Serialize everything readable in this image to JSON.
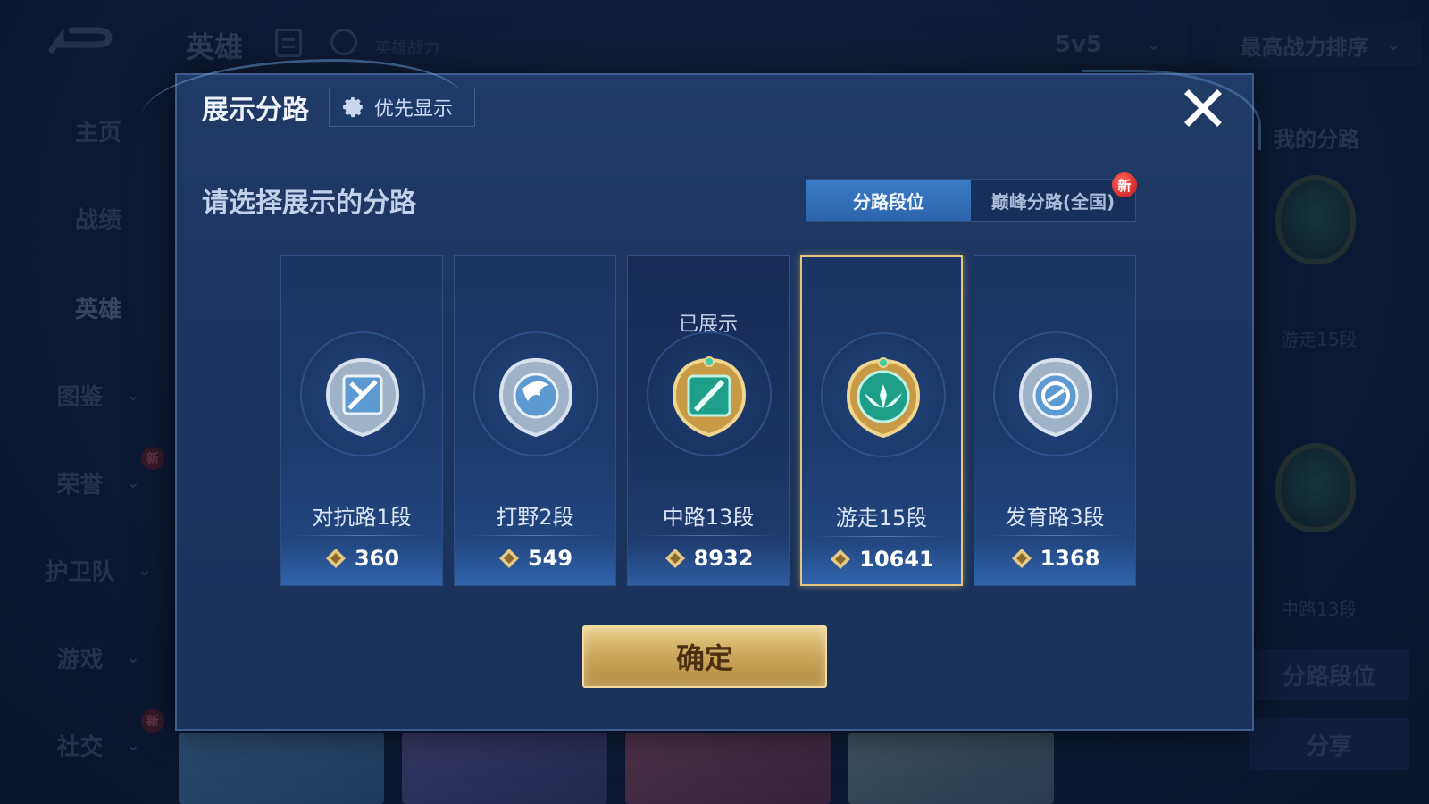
{
  "background": {
    "page_title": "英雄",
    "power_label": "英雄战力",
    "mode_select": "5v5",
    "sort_select": "最高战力排序",
    "sidebar": [
      {
        "label": "主页",
        "badge": "",
        "chevron": false
      },
      {
        "label": "战绩",
        "badge": "",
        "chevron": false
      },
      {
        "label": "英雄",
        "badge": "",
        "chevron": false,
        "active": true
      },
      {
        "label": "图鉴",
        "badge": "",
        "chevron": true
      },
      {
        "label": "荣誉",
        "badge": "新",
        "chevron": true
      },
      {
        "label": "护卫队",
        "badge": "",
        "chevron": true
      },
      {
        "label": "游戏",
        "badge": "",
        "chevron": true
      },
      {
        "label": "社交",
        "badge": "新",
        "chevron": true
      }
    ],
    "right_panel": {
      "title": "我的分路",
      "lane1": "游走15段",
      "lane2": "中路13段",
      "lane_button": "分路段位",
      "share_button": "分享"
    }
  },
  "modal": {
    "title": "展示分路",
    "priority_button": "优先显示",
    "prompt": "请选择展示的分路",
    "tabs": [
      {
        "label": "分路段位",
        "active": true,
        "badge": ""
      },
      {
        "label": "巅峰分路(全国)",
        "active": false,
        "badge": "新"
      }
    ],
    "shown_label": "已展示",
    "cards": [
      {
        "name": "对抗路1段",
        "score": "360",
        "icon": "clash-lane-icon",
        "tier": "silver",
        "shown": false,
        "selected": false
      },
      {
        "name": "打野2段",
        "score": "549",
        "icon": "jungle-dragon-icon",
        "tier": "silver",
        "shown": false,
        "selected": false
      },
      {
        "name": "中路13段",
        "score": "8932",
        "icon": "mid-lane-icon",
        "tier": "gold-green",
        "shown": true,
        "selected": false
      },
      {
        "name": "游走15段",
        "score": "10641",
        "icon": "roam-wings-icon",
        "tier": "gold-green",
        "shown": false,
        "selected": true
      },
      {
        "name": "发育路3段",
        "score": "1368",
        "icon": "farm-lane-icon",
        "tier": "silver",
        "shown": false,
        "selected": false
      }
    ],
    "confirm_button": "确定"
  },
  "colors": {
    "accent_blue": "#3b7cc8",
    "gold": "#e4c47e",
    "badge_red": "#d82a2a",
    "modal_bg": "#1c3560"
  }
}
